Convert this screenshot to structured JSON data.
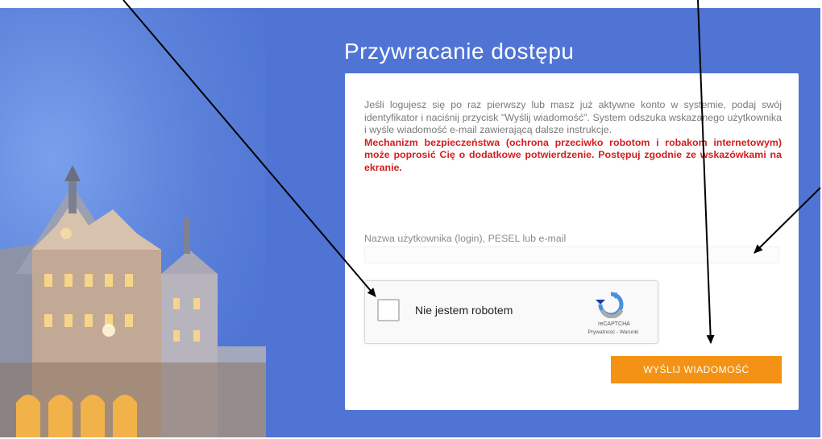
{
  "title": "Przywracanie dostępu",
  "description": {
    "info": "Jeśli logujesz się po raz pierwszy lub masz już aktywne konto w systemie, podaj swój identyfikator i naciśnij przycisk \"Wyślij wiadomość\". System odszuka wskazanego użytkownika i wyśle wiadomość e-mail zawierającą dalsze instrukcje.",
    "warning": "Mechanizm bezpieczeństwa (ochrona przeciwko robotom i robakom internetowym) może poprosić Cię o dodatkowe potwierdzenie. Postępuj zgodnie ze wskazówkami na ekranie."
  },
  "form": {
    "field_label": "Nazwa użytkownika (login), PESEL lub e-mail",
    "field_value": ""
  },
  "captcha": {
    "label": "Nie jestem robotem",
    "brand": "reCAPTCHA",
    "links": "Prywatność - Warunki"
  },
  "submit_label": "WYŚLIJ WIADOMOŚĆ",
  "colors": {
    "background": "#4f74d4",
    "button": "#f39214",
    "warning_text": "#d21f1f"
  }
}
